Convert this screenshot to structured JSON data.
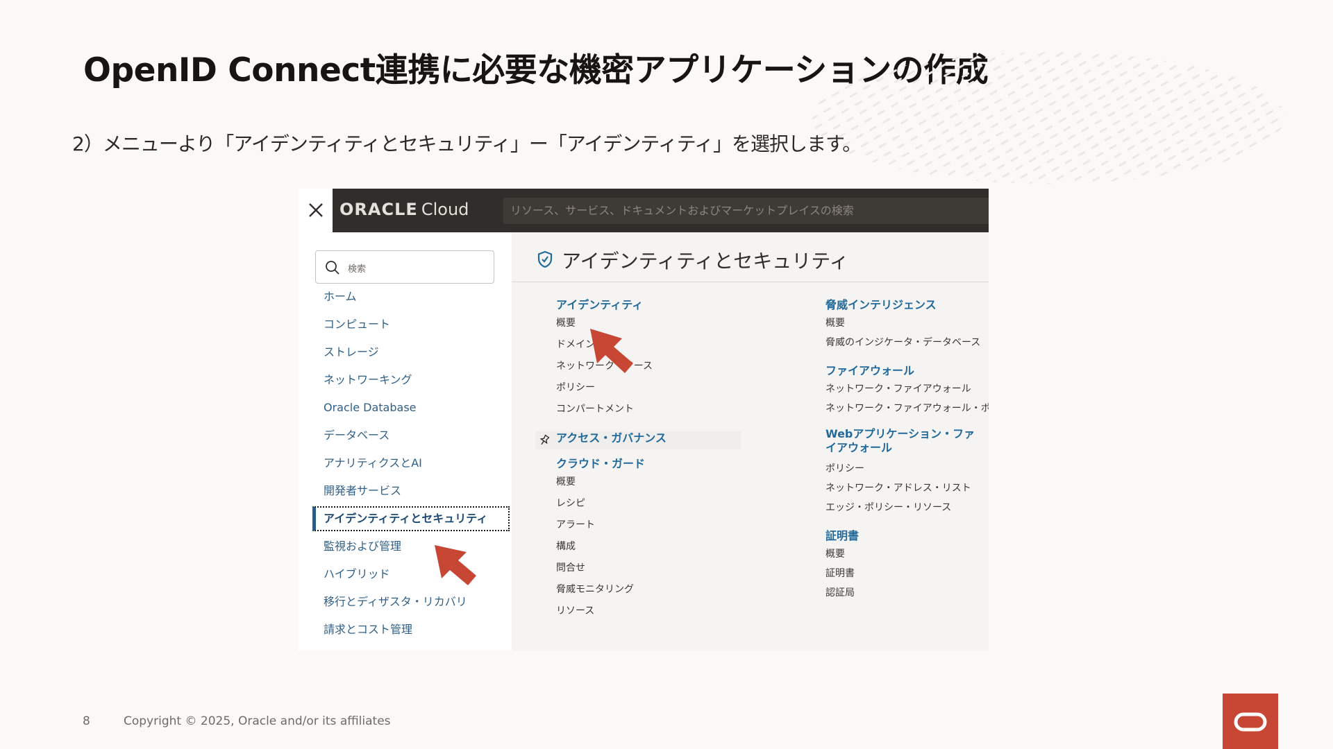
{
  "slide": {
    "title": "OpenID Connect連携に必要な機密アプリケーションの作成",
    "subtitle": "2）メニューより「アイデンティティとセキュリティ」ー「アイデンティティ」を選択します。",
    "page_number": "8",
    "copyright": "Copyright © 2025, Oracle and/or its affiliates",
    "brand_color": "#C74634",
    "logo_icon": "oracle-o-icon"
  },
  "console": {
    "close_icon": "close-icon",
    "logo_bold": "ORACLE",
    "logo_light": "Cloud",
    "search_placeholder": "リソース、サービス、ドキュメントおよびマーケットプレイスの検索",
    "sidebar": {
      "search_placeholder": "検索",
      "items": [
        "ホーム",
        "コンピュート",
        "ストレージ",
        "ネットワーキング",
        "Oracle Database",
        "データベース",
        "アナリティクスとAI",
        "開発者サービス",
        "アイデンティティとセキュリティ",
        "監視および管理",
        "ハイブリッド",
        "移行とディザスタ・リカバリ",
        "請求とコスト管理"
      ],
      "active_index": 8
    },
    "main": {
      "title": "アイデンティティとセキュリティ",
      "col1": [
        {
          "heading": "アイデンティティ",
          "items": [
            "概要",
            "ドメイン",
            "ネットワーク・ソース",
            "ポリシー",
            "コンパートメント"
          ]
        },
        {
          "heading": "アクセス・ガバナンス",
          "items": [],
          "pinned": true
        },
        {
          "heading": "クラウド・ガード",
          "items": [
            "概要",
            "レシピ",
            "アラート",
            "構成",
            "問合せ",
            "脅威モニタリング",
            "リソース"
          ]
        }
      ],
      "col2": [
        {
          "heading": "脅威インテリジェンス",
          "items": [
            "概要",
            "脅威のインジケータ・データベース"
          ]
        },
        {
          "heading": "ファイアウォール",
          "items": [
            "ネットワーク・ファイアウォール",
            "ネットワーク・ファイアウォール・ポリシー"
          ]
        },
        {
          "heading": "Webアプリケーション・ファイアウォール",
          "items": [
            "ポリシー",
            "ネットワーク・アドレス・リスト",
            "エッジ・ポリシー・リソース"
          ]
        },
        {
          "heading": "証明書",
          "items": [
            "概要",
            "証明書",
            "認証局"
          ]
        }
      ]
    },
    "arrow_color": "#C74634"
  }
}
